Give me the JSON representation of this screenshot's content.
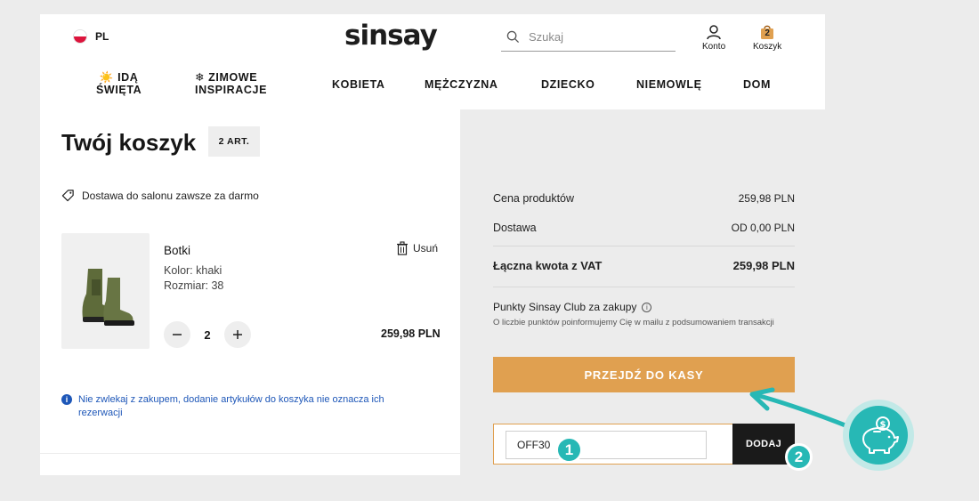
{
  "header": {
    "lang": "PL",
    "logo": "sinsay",
    "search_placeholder": "Szukaj",
    "account_label": "Konto",
    "cart_label": "Koszyk",
    "cart_count": "2"
  },
  "nav": {
    "promo1_line1": "☀️ IDĄ",
    "promo1_line2": "ŚWIĘTA",
    "promo2_line1": "❄ ZIMOWE",
    "promo2_line2": "INSPIRACJE",
    "items": [
      "KOBIETA",
      "MĘŻCZYZNA",
      "DZIECKO",
      "NIEMOWLĘ",
      "DOM"
    ]
  },
  "cart": {
    "title": "Twój koszyk",
    "count_badge": "2 ART.",
    "delivery_note": "Dostawa do salonu zawsze za darmo",
    "product": {
      "name": "Botki",
      "color": "Kolor: khaki",
      "size": "Rozmiar: 38",
      "remove_label": "Usuń",
      "quantity": "2",
      "price": "259,98 PLN"
    },
    "info_note": "Nie zwlekaj z zakupem, dodanie artykułów do koszyka nie oznacza ich rezerwacji"
  },
  "summary": {
    "products_label": "Cena produktów",
    "products_value": "259,98 PLN",
    "shipping_label": "Dostawa",
    "shipping_value": "OD 0,00 PLN",
    "total_label": "Łączna kwota z VAT",
    "total_value": "259,98 PLN",
    "points_label": "Punkty Sinsay Club za zakupy",
    "points_note": "O liczbie punktów poinformujemy Cię w mailu z podsumowaniem transakcji",
    "checkout_label": "PRZEJDŹ DO KASY",
    "promo_code_value": "OFF30",
    "promo_button": "DODAJ"
  },
  "annotations": {
    "step1": "1",
    "step2": "2"
  },
  "colors": {
    "accent_orange": "#e0a050",
    "teal": "#27b8b5",
    "info_blue": "#1e57b8"
  }
}
